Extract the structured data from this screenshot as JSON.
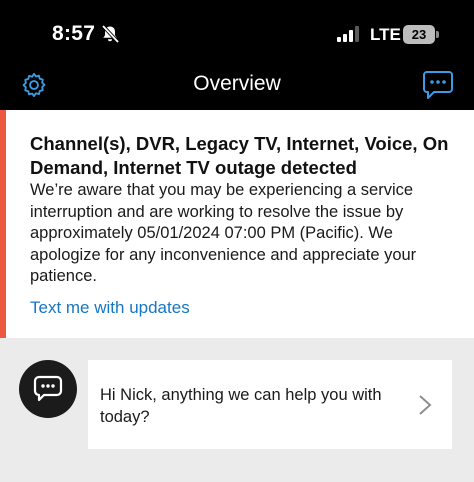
{
  "status_bar": {
    "time": "8:57",
    "network": "LTE",
    "battery_level": "23",
    "icons": [
      "bell-slash-icon",
      "cellular-signal-icon",
      "battery-icon"
    ]
  },
  "nav": {
    "title": "Overview",
    "left_icon": "gear-icon",
    "right_icon": "chat-bubble-icon"
  },
  "outage": {
    "title": "Channel(s), DVR, Legacy TV, Internet, Voice, On Demand, Internet TV outage detected",
    "message": "We’re aware that you may be experiencing a service interruption and are working to resolve the issue by approximately 05/01/2024 07:00 PM (Pacific).  We apologize for any inconvenience and appreciate your patience.",
    "link_label": "Text me with updates",
    "accent_color": "#ec5840",
    "link_color": "#1777c4"
  },
  "assistant": {
    "avatar_icon": "chat-bot-icon",
    "greeting": "Hi Nick, anything we can help you with today?"
  }
}
